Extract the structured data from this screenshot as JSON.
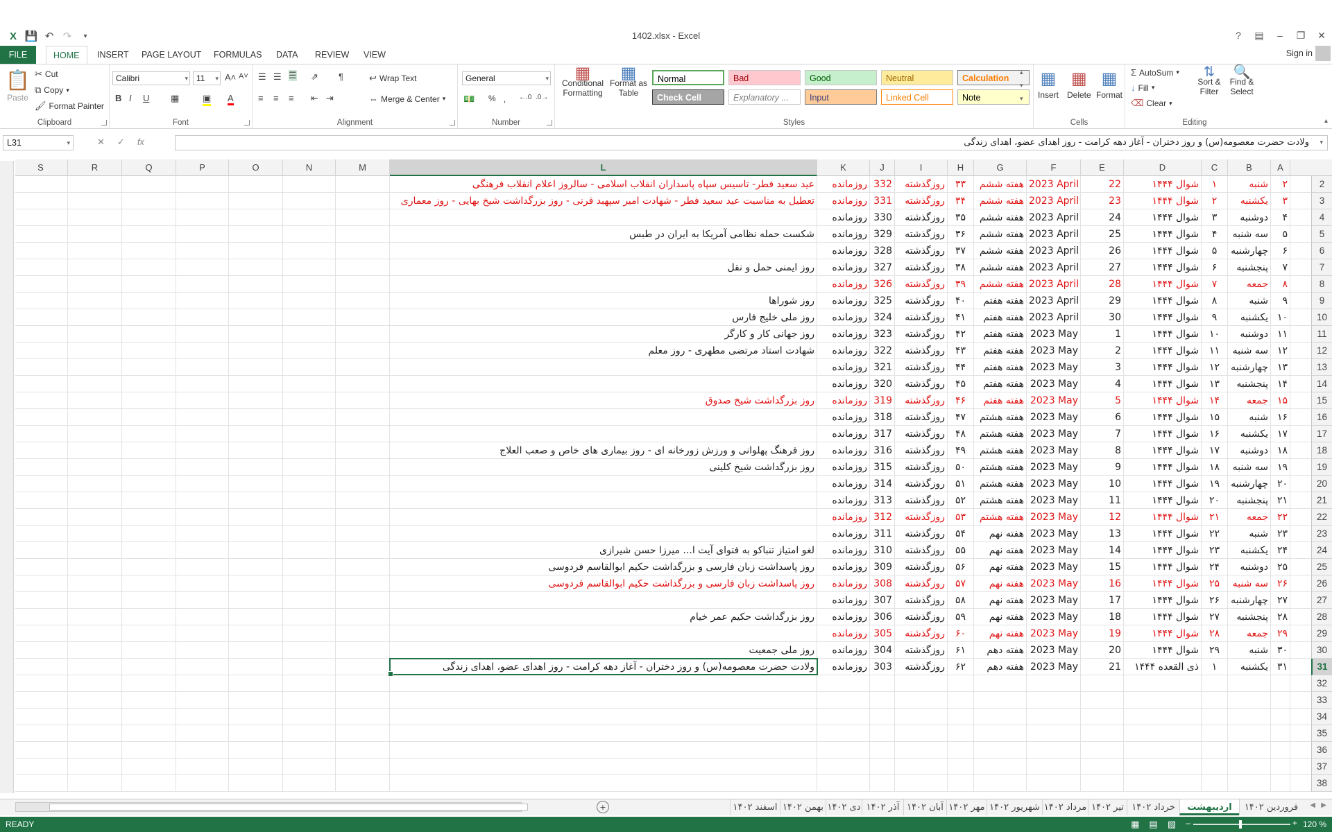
{
  "window": {
    "title": "1402.xlsx - Excel",
    "help": "?",
    "min": "–",
    "restore": "❐",
    "close": "✕"
  },
  "tabs": [
    "FILE",
    "HOME",
    "INSERT",
    "PAGE LAYOUT",
    "FORMULAS",
    "DATA",
    "REVIEW",
    "VIEW"
  ],
  "signin": "Sign in",
  "ribbon": {
    "clipboard": {
      "label": "Clipboard",
      "paste": "Paste",
      "cut": "Cut",
      "copy": "Copy",
      "format_painter": "Format Painter"
    },
    "font": {
      "label": "Font",
      "name": "Calibri",
      "size": "11"
    },
    "alignment": {
      "label": "Alignment",
      "wrap": "Wrap Text",
      "merge": "Merge & Center"
    },
    "number": {
      "label": "Number",
      "format": "General",
      "percent": "%"
    },
    "styles": {
      "label": "Styles",
      "conditional": "Conditional Formatting",
      "format_table": "Format as Table",
      "boxes": [
        {
          "text": "Normal",
          "bg": "#ffffff",
          "fg": "#000000",
          "border": "#5aa65a"
        },
        {
          "text": "Bad",
          "bg": "#ffc7ce",
          "fg": "#9c0006",
          "border": "#c8c8c8"
        },
        {
          "text": "Good",
          "bg": "#c6efce",
          "fg": "#006100",
          "border": "#c8c8c8"
        },
        {
          "text": "Neutral",
          "bg": "#ffeb9c",
          "fg": "#9c6500",
          "border": "#c8c8c8"
        },
        {
          "text": "Calculation",
          "bg": "#f2f2f2",
          "fg": "#fa7d00",
          "border": "#7f7f7f"
        },
        {
          "text": "Check Cell",
          "bg": "#a5a5a5",
          "fg": "#ffffff",
          "border": "#3f3f3f"
        },
        {
          "text": "Explanatory ...",
          "bg": "#ffffff",
          "fg": "#7f7f7f",
          "border": "#c8c8c8"
        },
        {
          "text": "Input",
          "bg": "#ffcc99",
          "fg": "#3f3f76",
          "border": "#7f7f7f"
        },
        {
          "text": "Linked Cell",
          "bg": "#ffffff",
          "fg": "#fa7d00",
          "border": "#ff8001"
        },
        {
          "text": "Note",
          "bg": "#ffffcc",
          "fg": "#000000",
          "border": "#b2b2b2"
        }
      ]
    },
    "cells": {
      "label": "Cells",
      "insert": "Insert",
      "delete": "Delete",
      "format": "Format"
    },
    "editing": {
      "label": "Editing",
      "autosum": "AutoSum",
      "fill": "Fill",
      "clear": "Clear",
      "sort": "Sort & Filter",
      "find": "Find & Select"
    }
  },
  "formula_bar": {
    "name_box": "L31",
    "fx": "fx",
    "content": "ولادت حضرت معصومه(س) و روز دختران - آغاز دهه کرامت - روز اهدای عضو، اهدای زندگی"
  },
  "columns": [
    "A",
    "B",
    "C",
    "D",
    "E",
    "F",
    "G",
    "H",
    "I",
    "J",
    "K",
    "L",
    "M",
    "N",
    "O",
    "P",
    "Q",
    "R",
    "S"
  ],
  "selected": {
    "col": "L",
    "row": "31"
  },
  "rows": [
    {
      "n": "2",
      "red": true,
      "a": "۲",
      "b": "شنبه",
      "c": "۱",
      "d": "شوال ۱۴۴۴",
      "e": "22",
      "f": "2023 April",
      "g": "هفته ششم",
      "h": "۳۳",
      "i": "روزگذشته",
      "j": "332",
      "k": "روزمانده",
      "l": "عید سعید فطر- تاسیس سپاه پاسداران انقلاب اسلامی - سالروز اعلام انقلاب فرهنگی"
    },
    {
      "n": "3",
      "red": true,
      "a": "۳",
      "b": "یکشنبه",
      "c": "۲",
      "d": "شوال ۱۴۴۴",
      "e": "23",
      "f": "2023 April",
      "g": "هفته ششم",
      "h": "۳۴",
      "i": "روزگذشته",
      "j": "331",
      "k": "روزمانده",
      "l": "تعطیل به مناسبت عید سعید فطر - شهادت امیر سپهبد قرنی - روز بزرگداشت شیخ بهایی - روز معماری"
    },
    {
      "n": "4",
      "red": false,
      "a": "۴",
      "b": "دوشنبه",
      "c": "۳",
      "d": "شوال ۱۴۴۴",
      "e": "24",
      "f": "2023 April",
      "g": "هفته ششم",
      "h": "۳۵",
      "i": "روزگذشته",
      "j": "330",
      "k": "روزمانده",
      "l": ""
    },
    {
      "n": "5",
      "red": false,
      "a": "۵",
      "b": "سه شنبه",
      "c": "۴",
      "d": "شوال ۱۴۴۴",
      "e": "25",
      "f": "2023 April",
      "g": "هفته ششم",
      "h": "۳۶",
      "i": "روزگذشته",
      "j": "329",
      "k": "روزمانده",
      "l": "شکست حمله نظامی آمریکا به ایران در طبس"
    },
    {
      "n": "6",
      "red": false,
      "a": "۶",
      "b": "چهارشنبه",
      "c": "۵",
      "d": "شوال ۱۴۴۴",
      "e": "26",
      "f": "2023 April",
      "g": "هفته ششم",
      "h": "۳۷",
      "i": "روزگذشته",
      "j": "328",
      "k": "روزمانده",
      "l": ""
    },
    {
      "n": "7",
      "red": false,
      "a": "۷",
      "b": "پنجشنبه",
      "c": "۶",
      "d": "شوال ۱۴۴۴",
      "e": "27",
      "f": "2023 April",
      "g": "هفته ششم",
      "h": "۳۸",
      "i": "روزگذشته",
      "j": "327",
      "k": "روزمانده",
      "l": "روز ایمنی حمل و نقل"
    },
    {
      "n": "8",
      "red": true,
      "a": "۸",
      "b": "جمعه",
      "c": "۷",
      "d": "شوال ۱۴۴۴",
      "e": "28",
      "f": "2023 April",
      "g": "هفته ششم",
      "h": "۳۹",
      "i": "روزگذشته",
      "j": "326",
      "k": "روزمانده",
      "l": ""
    },
    {
      "n": "9",
      "red": false,
      "a": "۹",
      "b": "شنبه",
      "c": "۸",
      "d": "شوال ۱۴۴۴",
      "e": "29",
      "f": "2023 April",
      "g": "هفته هفتم",
      "h": "۴۰",
      "i": "روزگذشته",
      "j": "325",
      "k": "روزمانده",
      "l": "روز شوراها"
    },
    {
      "n": "10",
      "red": false,
      "a": "۱۰",
      "b": "یکشنبه",
      "c": "۹",
      "d": "شوال ۱۴۴۴",
      "e": "30",
      "f": "2023 April",
      "g": "هفته هفتم",
      "h": "۴۱",
      "i": "روزگذشته",
      "j": "324",
      "k": "روزمانده",
      "l": "روز ملی خلیج فارس"
    },
    {
      "n": "11",
      "red": false,
      "a": "۱۱",
      "b": "دوشنبه",
      "c": "۱۰",
      "d": "شوال ۱۴۴۴",
      "e": "1",
      "f": "2023 May",
      "g": "هفته هفتم",
      "h": "۴۲",
      "i": "روزگذشته",
      "j": "323",
      "k": "روزمانده",
      "l": "روز جهانی کار و کارگر"
    },
    {
      "n": "12",
      "red": false,
      "a": "۱۲",
      "b": "سه شنبه",
      "c": "۱۱",
      "d": "شوال ۱۴۴۴",
      "e": "2",
      "f": "2023 May",
      "g": "هفته هفتم",
      "h": "۴۳",
      "i": "روزگذشته",
      "j": "322",
      "k": "روزمانده",
      "l": "شهادت استاد مرتضی مطهری - روز معلم"
    },
    {
      "n": "13",
      "red": false,
      "a": "۱۳",
      "b": "چهارشنبه",
      "c": "۱۲",
      "d": "شوال ۱۴۴۴",
      "e": "3",
      "f": "2023 May",
      "g": "هفته هفتم",
      "h": "۴۴",
      "i": "روزگذشته",
      "j": "321",
      "k": "روزمانده",
      "l": ""
    },
    {
      "n": "14",
      "red": false,
      "a": "۱۴",
      "b": "پنجشنبه",
      "c": "۱۳",
      "d": "شوال ۱۴۴۴",
      "e": "4",
      "f": "2023 May",
      "g": "هفته هفتم",
      "h": "۴۵",
      "i": "روزگذشته",
      "j": "320",
      "k": "روزمانده",
      "l": ""
    },
    {
      "n": "15",
      "red": true,
      "a": "۱۵",
      "b": "جمعه",
      "c": "۱۴",
      "d": "شوال ۱۴۴۴",
      "e": "5",
      "f": "2023 May",
      "g": "هفته هفتم",
      "h": "۴۶",
      "i": "روزگذشته",
      "j": "319",
      "k": "روزمانده",
      "l": "روز بزرگداشت شیخ صدوق"
    },
    {
      "n": "16",
      "red": false,
      "a": "۱۶",
      "b": "شنبه",
      "c": "۱۵",
      "d": "شوال ۱۴۴۴",
      "e": "6",
      "f": "2023 May",
      "g": "هفته هشتم",
      "h": "۴۷",
      "i": "روزگذشته",
      "j": "318",
      "k": "روزمانده",
      "l": ""
    },
    {
      "n": "17",
      "red": false,
      "a": "۱۷",
      "b": "یکشنبه",
      "c": "۱۶",
      "d": "شوال ۱۴۴۴",
      "e": "7",
      "f": "2023 May",
      "g": "هفته هشتم",
      "h": "۴۸",
      "i": "روزگذشته",
      "j": "317",
      "k": "روزمانده",
      "l": ""
    },
    {
      "n": "18",
      "red": false,
      "a": "۱۸",
      "b": "دوشنبه",
      "c": "۱۷",
      "d": "شوال ۱۴۴۴",
      "e": "8",
      "f": "2023 May",
      "g": "هفته هشتم",
      "h": "۴۹",
      "i": "روزگذشته",
      "j": "316",
      "k": "روزمانده",
      "l": "روز فرهنگ پهلوانی و ورزش زورخانه ای - روز بیماری های خاص و صعب العلاج"
    },
    {
      "n": "19",
      "red": false,
      "a": "۱۹",
      "b": "سه شنبه",
      "c": "۱۸",
      "d": "شوال ۱۴۴۴",
      "e": "9",
      "f": "2023 May",
      "g": "هفته هشتم",
      "h": "۵۰",
      "i": "روزگذشته",
      "j": "315",
      "k": "روزمانده",
      "l": "روز بزرگداشت شیخ کلینی"
    },
    {
      "n": "20",
      "red": false,
      "a": "۲۰",
      "b": "چهارشنبه",
      "c": "۱۹",
      "d": "شوال ۱۴۴۴",
      "e": "10",
      "f": "2023 May",
      "g": "هفته هشتم",
      "h": "۵۱",
      "i": "روزگذشته",
      "j": "314",
      "k": "روزمانده",
      "l": ""
    },
    {
      "n": "21",
      "red": false,
      "a": "۲۱",
      "b": "پنجشنبه",
      "c": "۲۰",
      "d": "شوال ۱۴۴۴",
      "e": "11",
      "f": "2023 May",
      "g": "هفته هشتم",
      "h": "۵۲",
      "i": "روزگذشته",
      "j": "313",
      "k": "روزمانده",
      "l": ""
    },
    {
      "n": "22",
      "red": true,
      "a": "۲۲",
      "b": "جمعه",
      "c": "۲۱",
      "d": "شوال ۱۴۴۴",
      "e": "12",
      "f": "2023 May",
      "g": "هفته هشتم",
      "h": "۵۳",
      "i": "روزگذشته",
      "j": "312",
      "k": "روزمانده",
      "l": ""
    },
    {
      "n": "23",
      "red": false,
      "a": "۲۳",
      "b": "شنبه",
      "c": "۲۲",
      "d": "شوال ۱۴۴۴",
      "e": "13",
      "f": "2023 May",
      "g": "هفته نهم",
      "h": "۵۴",
      "i": "روزگذشته",
      "j": "311",
      "k": "روزمانده",
      "l": ""
    },
    {
      "n": "24",
      "red": false,
      "a": "۲۴",
      "b": "یکشنبه",
      "c": "۲۳",
      "d": "شوال ۱۴۴۴",
      "e": "14",
      "f": "2023 May",
      "g": "هفته نهم",
      "h": "۵۵",
      "i": "روزگذشته",
      "j": "310",
      "k": "روزمانده",
      "l": "لغو امتیاز تنباکو به فتوای آیت ا... میرزا حسن شیرازی"
    },
    {
      "n": "25",
      "red": false,
      "a": "۲۵",
      "b": "دوشنبه",
      "c": "۲۴",
      "d": "شوال ۱۴۴۴",
      "e": "15",
      "f": "2023 May",
      "g": "هفته نهم",
      "h": "۵۶",
      "i": "روزگذشته",
      "j": "309",
      "k": "روزمانده",
      "l": "روز پاسداشت زبان فارسی و بزرگداشت حکیم ابوالقاسم فردوسی"
    },
    {
      "n": "26",
      "red": true,
      "a": "۲۶",
      "b": "سه شنبه",
      "c": "۲۵",
      "d": "شوال ۱۴۴۴",
      "e": "16",
      "f": "2023 May",
      "g": "هفته نهم",
      "h": "۵۷",
      "i": "روزگذشته",
      "j": "308",
      "k": "روزمانده",
      "l": "روز پاسداشت زبان فارسی و بزرگداشت حکیم ابوالقاسم فردوسی"
    },
    {
      "n": "27",
      "red": false,
      "a": "۲۷",
      "b": "چهارشنبه",
      "c": "۲۶",
      "d": "شوال ۱۴۴۴",
      "e": "17",
      "f": "2023 May",
      "g": "هفته نهم",
      "h": "۵۸",
      "i": "روزگذشته",
      "j": "307",
      "k": "روزمانده",
      "l": ""
    },
    {
      "n": "28",
      "red": false,
      "a": "۲۸",
      "b": "پنجشنبه",
      "c": "۲۷",
      "d": "شوال ۱۴۴۴",
      "e": "18",
      "f": "2023 May",
      "g": "هفته نهم",
      "h": "۵۹",
      "i": "روزگذشته",
      "j": "306",
      "k": "روزمانده",
      "l": "روز بزرگداشت حکیم عمر خیام"
    },
    {
      "n": "29",
      "red": true,
      "a": "۲۹",
      "b": "جمعه",
      "c": "۲۸",
      "d": "شوال ۱۴۴۴",
      "e": "19",
      "f": "2023 May",
      "g": "هفته نهم",
      "h": "۶۰",
      "i": "روزگذشته",
      "j": "305",
      "k": "روزمانده",
      "l": ""
    },
    {
      "n": "30",
      "red": false,
      "a": "۳۰",
      "b": "شنبه",
      "c": "۲۹",
      "d": "شوال ۱۴۴۴",
      "e": "20",
      "f": "2023 May",
      "g": "هفته دهم",
      "h": "۶۱",
      "i": "روزگذشته",
      "j": "304",
      "k": "روزمانده",
      "l": "روز ملی جمعیت"
    },
    {
      "n": "31",
      "red": false,
      "a": "۳۱",
      "b": "یکشنبه",
      "c": "۱",
      "d": "ذی القعده ۱۴۴۴",
      "e": "21",
      "f": "2023 May",
      "g": "هفته دهم",
      "h": "۶۲",
      "i": "روزگذشته",
      "j": "303",
      "k": "روزمانده",
      "l": "ولادت حضرت معصومه(س) و روز دختران - آغاز دهه کرامت - روز اهدای عضو، اهدای زندگی"
    },
    {
      "n": "32"
    },
    {
      "n": "33"
    },
    {
      "n": "34"
    },
    {
      "n": "35"
    },
    {
      "n": "36"
    },
    {
      "n": "37"
    },
    {
      "n": "38"
    }
  ],
  "sheets": [
    "فروردین ۱۴۰۲",
    "اردیبهشت ۱۴۰۲",
    "خرداد ۱۴۰۲",
    "تیر ۱۴۰۲",
    "مرداد ۱۴۰۲",
    "شهریور ۱۴۰۲",
    "مهر ۱۴۰۲",
    "آبان ۱۴۰۲",
    "آذر ۱۴۰۲",
    "دی ۱۴۰۲",
    "بهمن ۱۴۰۲",
    "اسفند ۱۴۰۲"
  ],
  "active_sheet": "اردیبهشت ۱۴۰۲",
  "status": {
    "ready": "READY",
    "zoom": "120 %"
  },
  "colors": {
    "accent": "#217346",
    "holiday_red": "#e01414"
  }
}
